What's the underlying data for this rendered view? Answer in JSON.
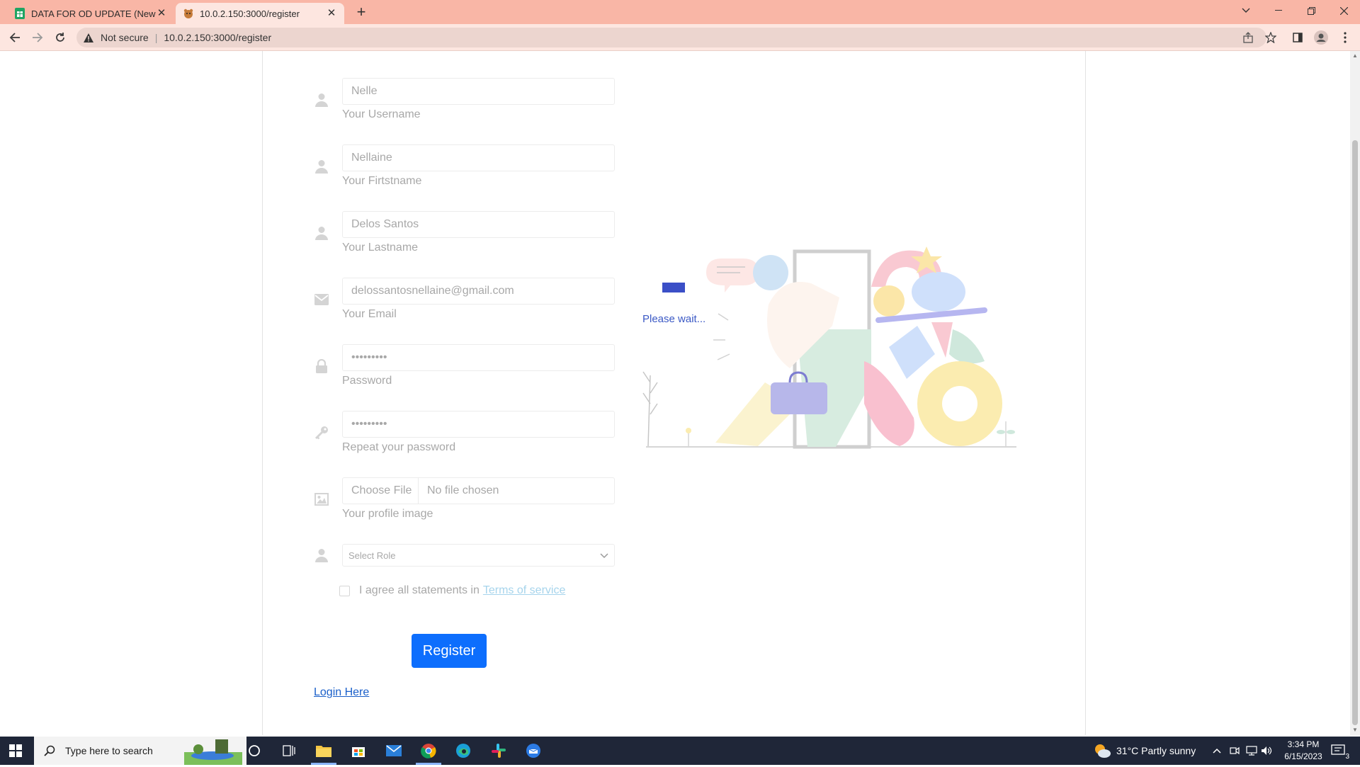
{
  "browser": {
    "tabs": [
      {
        "title": "DATA FOR OD UPDATE (New Cop",
        "favicon": "sheets-icon",
        "active": false
      },
      {
        "title": "10.0.2.150:3000/register",
        "favicon": "app-icon",
        "active": true
      }
    ],
    "new_tab": "+",
    "address": {
      "security_label": "Not secure",
      "url": "10.0.2.150:3000/register"
    }
  },
  "form": {
    "username": {
      "value": "Nelle",
      "label": "Your Username"
    },
    "firstname": {
      "value": "Nellaine",
      "label": "Your Firtstname"
    },
    "lastname": {
      "value": "Delos Santos",
      "label": "Your Lastname"
    },
    "email": {
      "value": "delossantosnellaine@gmail.com",
      "label": "Your Email"
    },
    "password": {
      "value": "•••••••••",
      "label": "Password"
    },
    "repeat_password": {
      "value": "•••••••••",
      "label": "Repeat your password"
    },
    "profile_image": {
      "button": "Choose File",
      "status": "No file chosen",
      "label": "Your profile image"
    },
    "role": {
      "selected": "Select Role"
    },
    "agree": {
      "text": "I agree all statements in",
      "link": "Terms of service"
    },
    "register_button": "Register",
    "login_link": "Login Here"
  },
  "loading_text": "Please wait...",
  "taskbar": {
    "search_placeholder": "Type here to search",
    "weather": "31°C  Partly sunny",
    "time": "3:34 PM",
    "date": "6/15/2023",
    "notification_count": "3"
  },
  "colors": {
    "accent": "#0d6efd",
    "tab_strip": "#f9b6a6",
    "taskbar": "#1f2638"
  }
}
